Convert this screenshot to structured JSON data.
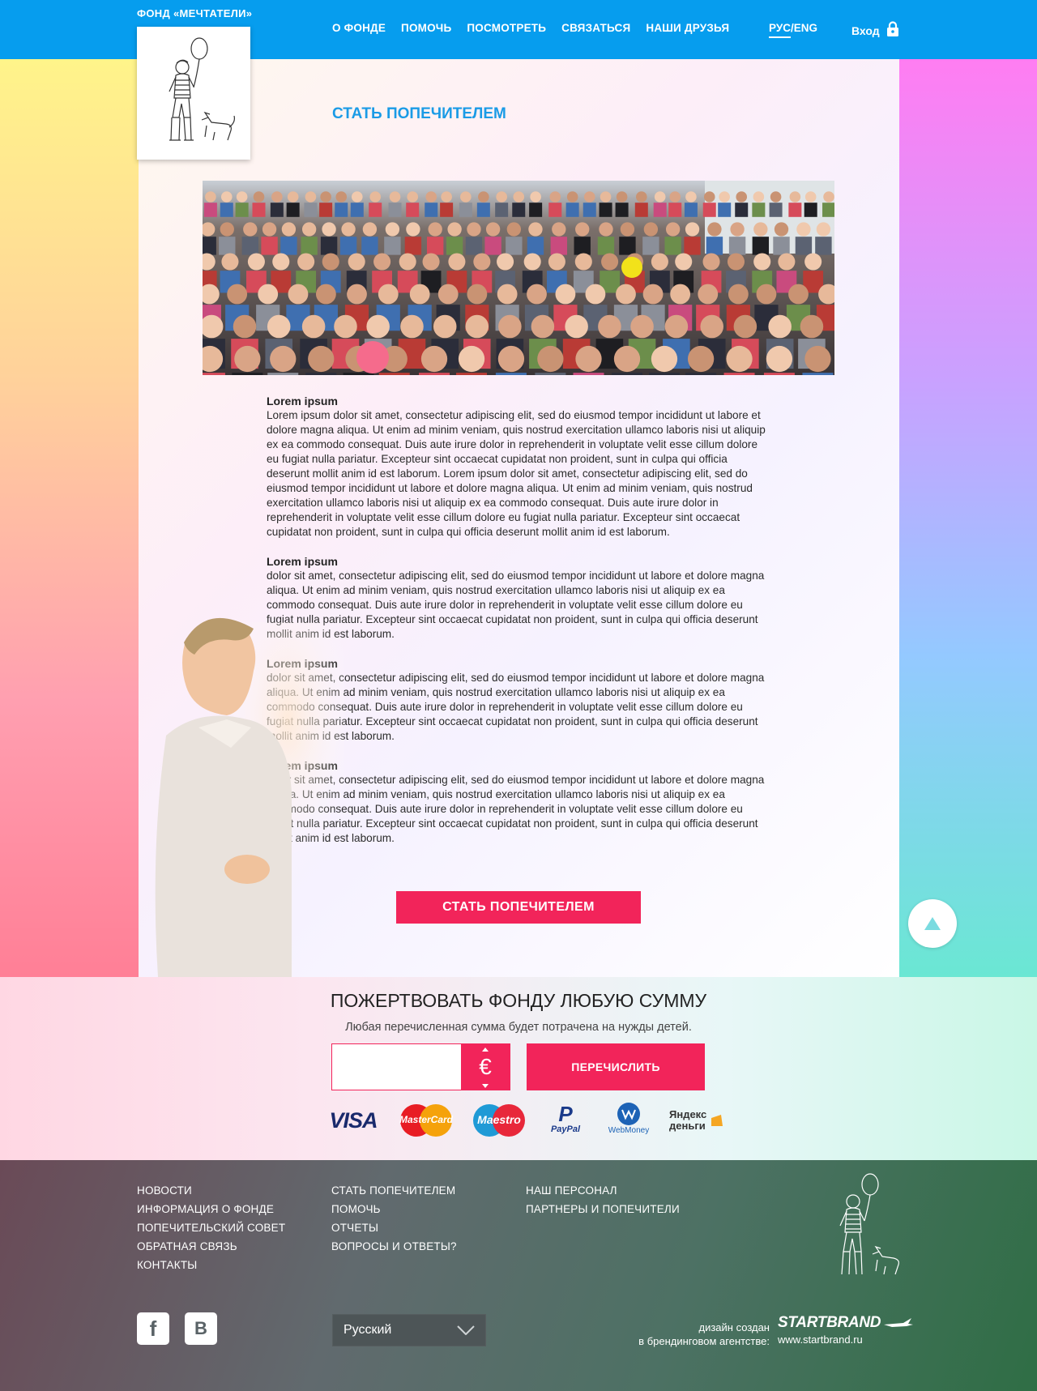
{
  "header": {
    "brand": "ФОНД «МЕЧТАТЕЛИ»",
    "nav": [
      "О ФОНДЕ",
      "ПОМОЧЬ",
      "ПОСМОТРЕТЬ",
      "СВЯЗАТЬСЯ",
      "НАШИ ДРУЗЬЯ"
    ],
    "lang_ru": "РУС",
    "lang_sep": "/",
    "lang_en": "ENG",
    "login": "Вход",
    "login_icon": "lock-icon"
  },
  "page": {
    "title": "СТАТЬ ПОПЕЧИТЕЛЕМ",
    "sections": [
      {
        "heading": "Lorem ipsum",
        "body": "Lorem ipsum dolor sit amet, consectetur adipiscing elit, sed do eiusmod tempor incididunt ut labore et dolore magna aliqua. Ut enim ad minim veniam, quis nostrud exercitation ullamco laboris nisi ut aliquip ex ea commodo consequat. Duis aute irure dolor in reprehenderit in voluptate velit esse cillum dolore eu fugiat nulla pariatur. Excepteur sint occaecat cupidatat non proident, sunt in culpa qui officia deserunt mollit anim id est laborum. Lorem ipsum dolor sit amet, consectetur adipiscing elit, sed do eiusmod tempor incididunt ut labore et dolore magna aliqua. Ut enim ad minim veniam, quis nostrud exercitation ullamco laboris nisi ut aliquip ex ea commodo consequat. Duis aute irure dolor in reprehenderit in voluptate velit esse cillum dolore eu fugiat nulla pariatur. Excepteur sint occaecat cupidatat non proident, sunt in culpa qui officia deserunt mollit anim id est laborum."
      },
      {
        "heading": "Lorem ipsum",
        "body": "dolor sit amet, consectetur adipiscing elit, sed do eiusmod tempor incididunt ut labore et dolore magna aliqua. Ut enim ad minim veniam, quis nostrud exercitation ullamco laboris nisi ut aliquip ex ea commodo consequat. Duis aute irure dolor in reprehenderit in voluptate velit esse cillum dolore eu fugiat nulla pariatur. Excepteur sint occaecat cupidatat non proident, sunt in culpa qui officia deserunt mollit anim id est laborum."
      },
      {
        "heading": "Lorem ipsum",
        "body": "dolor sit amet, consectetur adipiscing elit, sed do eiusmod tempor incididunt ut labore et dolore magna aliqua. Ut enim ad minim veniam, quis nostrud exercitation ullamco laboris nisi ut aliquip ex ea commodo consequat. Duis aute irure dolor in reprehenderit in voluptate velit esse cillum dolore eu fugiat nulla pariatur. Excepteur sint occaecat cupidatat non proident, sunt in culpa qui officia deserunt mollit anim id est laborum."
      },
      {
        "heading": "Lorem ipsum",
        "body": "dolor sit amet, consectetur adipiscing elit, sed do eiusmod tempor incididunt ut labore et dolore magna aliqua. Ut enim ad minim veniam, quis nostrud exercitation ullamco laboris nisi ut aliquip ex ea commodo consequat. Duis aute irure dolor in reprehenderit in voluptate velit esse cillum dolore eu fugiat nulla pariatur. Excepteur sint occaecat cupidatat non proident, sunt in culpa qui officia deserunt mollit anim id est laborum."
      }
    ],
    "cta": "СТАТЬ ПОПЕЧИТЕЛЕМ",
    "scroll_top_icon": "arrow-up-icon"
  },
  "donate": {
    "title": "ПОЖЕРТВОВАТЬ ФОНДУ ЛЮБУЮ СУММУ",
    "subtitle": "Любая перечисленная сумма будет потрачена на нужды детей.",
    "amount_value": "",
    "currency_symbol": "€",
    "submit": "ПЕРЕЧИСЛИТЬ",
    "payments": [
      "VISA",
      "MasterCard",
      "Maestro",
      "PayPal",
      "WebMoney",
      "Яндекс деньги"
    ]
  },
  "footer": {
    "col1": [
      "НОВОСТИ",
      "ИНФОРМАЦИЯ О ФОНДЕ",
      "ПОПЕЧИТЕЛЬСКИЙ СОВЕТ",
      "ОБРАТНАЯ СВЯЗЬ",
      "КОНТАКТЫ"
    ],
    "col2": [
      "СТАТЬ ПОПЕЧИТЕЛЕМ",
      "ПОМОЧЬ",
      "ОТЧЕТЫ",
      "ВОПРОСЫ И ОТВЕТЫ?"
    ],
    "col3": [
      "НАШ ПЕРСОНАЛ",
      "ПАРТНЕРЫ И ПОПЕЧИТЕЛИ"
    ],
    "social": [
      "facebook-icon",
      "vk-icon"
    ],
    "language_selected": "Русский",
    "credit_line1": "дизайн создан",
    "credit_line2": "в брендинговом агентстве:",
    "agency_name": "STARTBRAND",
    "agency_url": "www.startbrand.ru"
  },
  "colors": {
    "header_blue": "#069dee",
    "accent_pink": "#f2245a",
    "title_blue": "#1a9be6"
  }
}
